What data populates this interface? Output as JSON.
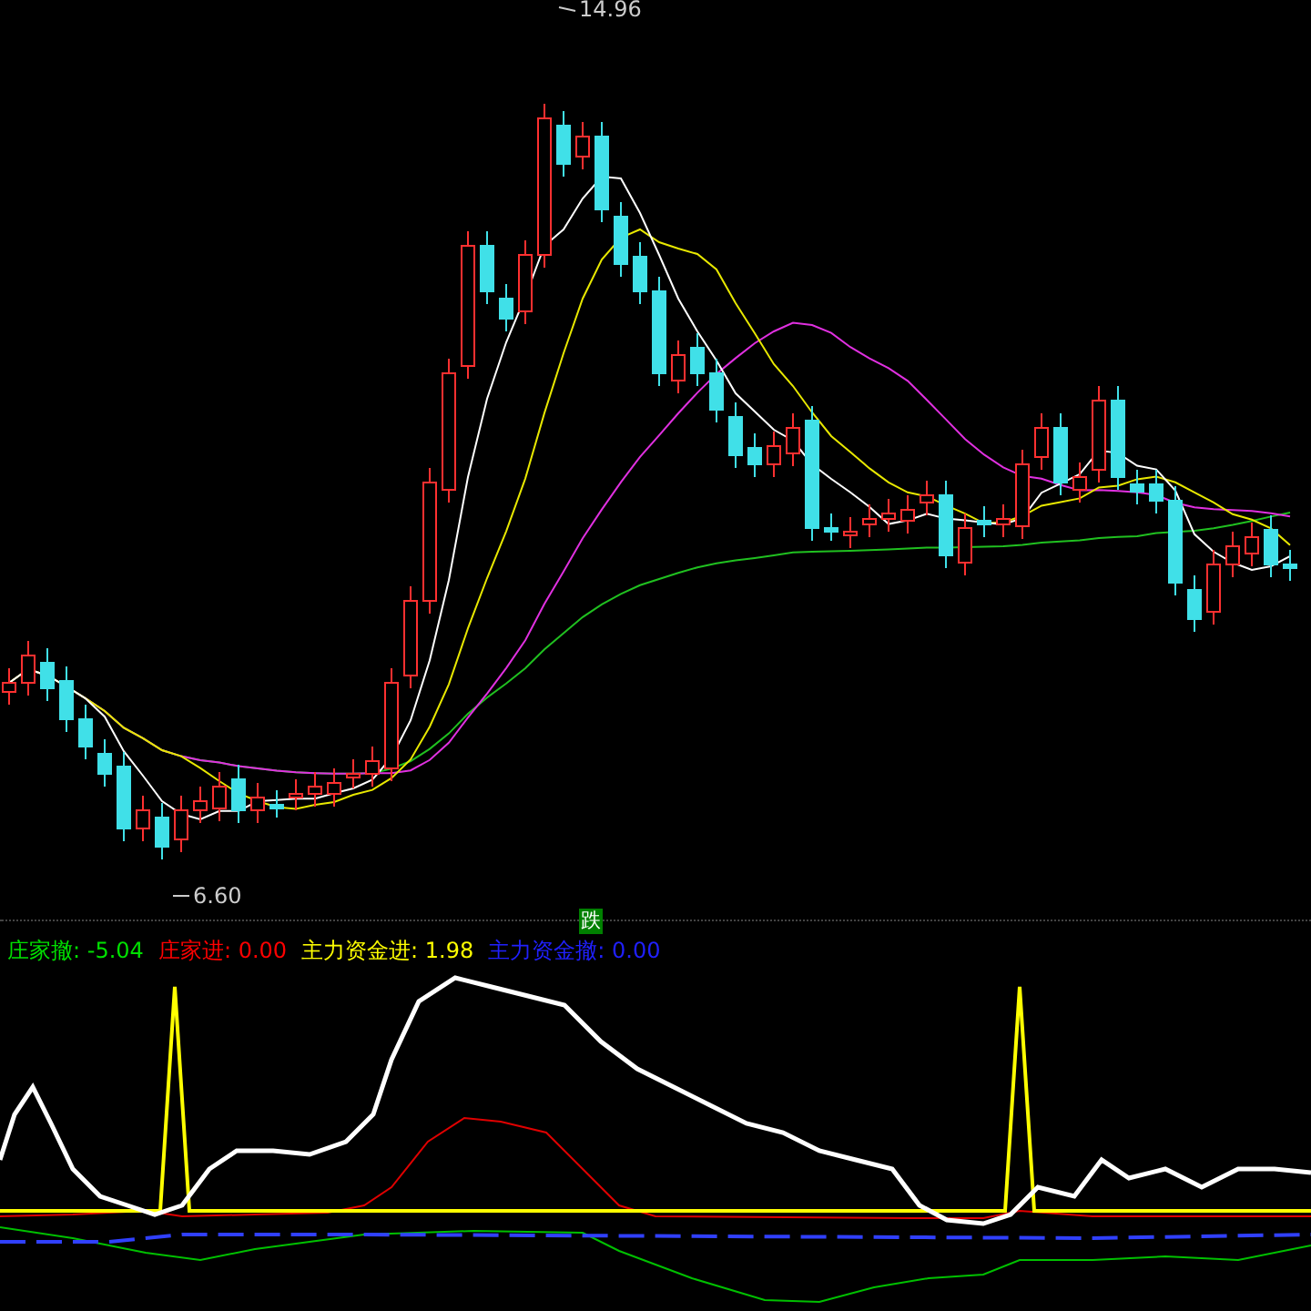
{
  "price_chart": {
    "high_label": "14.96",
    "low_label": "6.60"
  },
  "signal_badge": {
    "text": "跌"
  },
  "indicator": {
    "legend": [
      {
        "label": "庄家撤:",
        "value": "-5.04",
        "color": "#00e000"
      },
      {
        "label": "庄家进:",
        "value": "0.00",
        "color": "#ff0000"
      },
      {
        "label": "主力资金进:",
        "value": "1.98",
        "color": "#ffff00"
      },
      {
        "label": "主力资金撤:",
        "value": "0.00",
        "color": "#2020ff"
      }
    ]
  }
}
